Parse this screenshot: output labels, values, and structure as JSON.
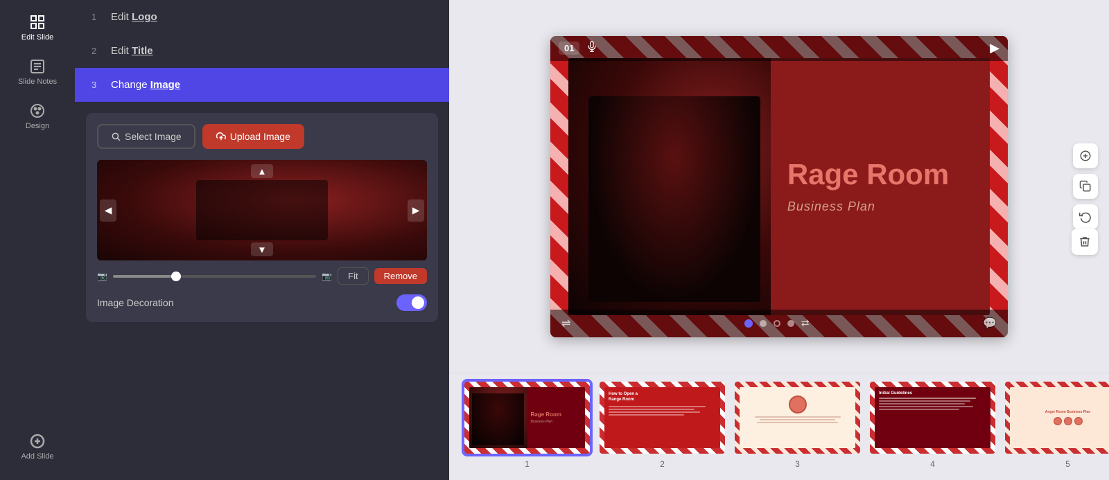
{
  "sidebar": {
    "items": [
      {
        "label": "Edit Slide",
        "icon": "grid-icon"
      },
      {
        "label": "Slide Notes",
        "icon": "notes-icon"
      },
      {
        "label": "Design",
        "icon": "palette-icon"
      },
      {
        "label": "Add Slide",
        "icon": "plus-icon"
      }
    ]
  },
  "steps": [
    {
      "num": "1",
      "prefix": "Edit",
      "highlight": "Logo"
    },
    {
      "num": "2",
      "prefix": "Edit",
      "highlight": "Title"
    },
    {
      "num": "3",
      "prefix": "Change",
      "highlight": "Image",
      "active": true
    }
  ],
  "image_panel": {
    "select_button": "Select Image",
    "upload_button": "Upload Image",
    "fit_button": "Fit",
    "remove_button": "Remove",
    "decoration_label": "Image Decoration",
    "decoration_enabled": true
  },
  "slide": {
    "number": "01",
    "title": "Rage Room",
    "subtitle": "Business  Plan"
  },
  "thumbnails": [
    {
      "num": "1",
      "selected": true
    },
    {
      "num": "2",
      "selected": false
    },
    {
      "num": "3",
      "selected": false
    },
    {
      "num": "4",
      "selected": false
    },
    {
      "num": "5",
      "selected": false
    }
  ],
  "toolbar": {
    "undo_label": "undo",
    "delete_label": "delete",
    "add_label": "add",
    "copy_label": "copy"
  }
}
